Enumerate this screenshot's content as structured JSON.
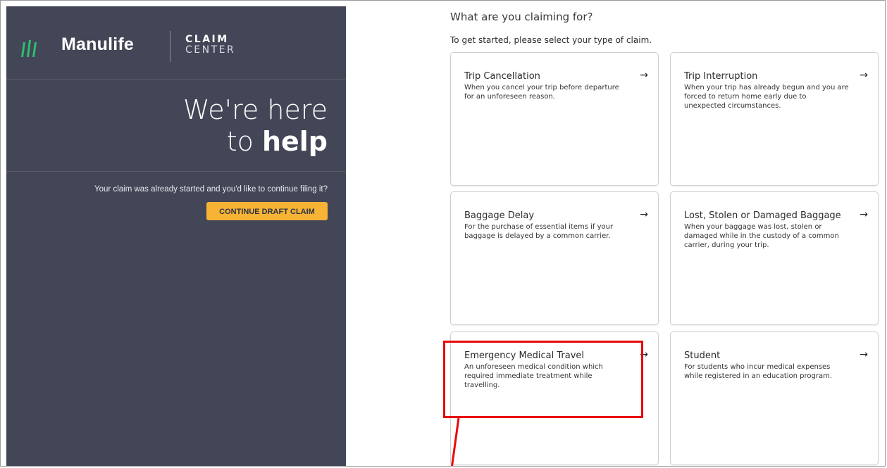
{
  "sidebar": {
    "brand_name": "Manulife",
    "product_line1": "CLAIM",
    "product_line2": "CENTER",
    "hero_line1": "We're here",
    "hero_line2_prefix": "to ",
    "hero_line2_strong": "help",
    "draft_prompt": "Your claim was already started and you'd like to continue filing it?",
    "draft_button": "CONTINUE DRAFT CLAIM"
  },
  "main": {
    "title": "What are you claiming for?",
    "subtitle": "To get started, please select your type of claim.",
    "cards": [
      {
        "title": "Trip Cancellation",
        "description": "When you cancel your trip before departure for an unforeseen reason."
      },
      {
        "title": "Trip Interruption",
        "description": "When your trip has already begun and you are forced to return home early due to unexpected circumstances."
      },
      {
        "title": "Baggage Delay",
        "description": "For the purchase of essential items if your baggage is delayed by a common carrier."
      },
      {
        "title": "Lost, Stolen or Damaged Baggage",
        "description": "When your baggage was lost, stolen or damaged while in the custody of a common carrier, during your trip."
      },
      {
        "title": "Emergency Medical Travel",
        "description": "An unforeseen medical condition which required immediate treatment while travelling."
      },
      {
        "title": "Student",
        "description": "For students who incur medical expenses while registered in an education program."
      }
    ],
    "arrow_glyph": "→"
  },
  "colors": {
    "sidebar_bg": "#424656",
    "brand_green": "#2dbe72",
    "cta_orange": "#f6b336",
    "annotation_red": "#e80a0a"
  }
}
